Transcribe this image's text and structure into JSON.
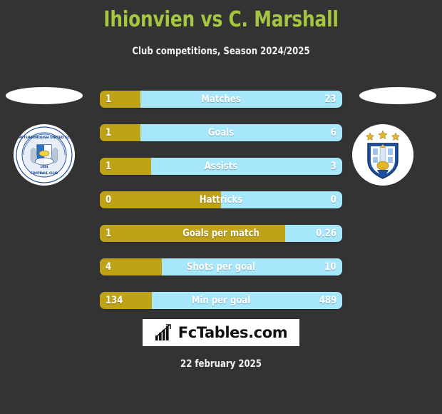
{
  "header": {
    "title": "Ihionvien vs C. Marshall",
    "subtitle": "Club competitions, Season 2024/2025",
    "title_color": "#a5c63f"
  },
  "teams": {
    "home": {
      "crest_name": "peterborough-united-crest",
      "crest_year": "1934"
    },
    "away": {
      "crest_name": "huddersfield-town-crest"
    }
  },
  "colors": {
    "background": "#333333",
    "home_bar": "#bfa216",
    "away_bar": "#a6e7fb",
    "value_text": "#ffffff"
  },
  "stats": [
    {
      "label": "Matches",
      "home": "1",
      "away": "23",
      "home_pct": 16.8
    },
    {
      "label": "Goals",
      "home": "1",
      "away": "6",
      "home_pct": 16.8
    },
    {
      "label": "Assists",
      "home": "1",
      "away": "3",
      "home_pct": 21.2
    },
    {
      "label": "Hattricks",
      "home": "0",
      "away": "0",
      "home_pct": 50.0
    },
    {
      "label": "Goals per match",
      "home": "1",
      "away": "0.26",
      "home_pct": 76.5
    },
    {
      "label": "Shots per goal",
      "home": "4",
      "away": "10",
      "home_pct": 25.6
    },
    {
      "label": "Min per goal",
      "home": "134",
      "away": "489",
      "home_pct": 21.5
    }
  ],
  "footer": {
    "brand": "FcTables.com",
    "brand_icon": "bar-chart-trend-icon",
    "date": "22 february 2025"
  }
}
